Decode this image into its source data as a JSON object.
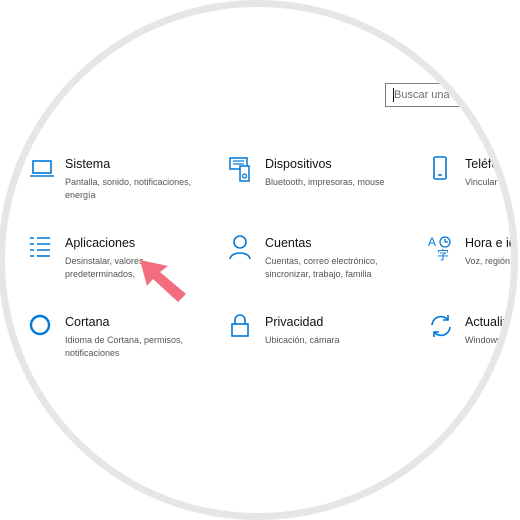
{
  "search": {
    "placeholder": "Buscar una c"
  },
  "items": [
    {
      "title": "Sistema",
      "desc": "Pantalla, sonido, notificaciones, energía",
      "icon": "laptop-icon"
    },
    {
      "title": "Dispositivos",
      "desc": "Bluetooth, impresoras, mouse",
      "icon": "devices-icon"
    },
    {
      "title": "Teléfo",
      "desc": "Vincular",
      "icon": "phone-icon"
    },
    {
      "title": "Aplicaciones",
      "desc": "Desinstalar, valores predeterminados,",
      "icon": "apps-list-icon"
    },
    {
      "title": "Cuentas",
      "desc": "Cuentas, correo electrónico, sincronizar, trabajo, familia",
      "icon": "person-icon"
    },
    {
      "title": "Hora e idi",
      "desc": "Voz, región,",
      "icon": "time-language-icon"
    },
    {
      "title": "Cortana",
      "desc": "Idioma de Cortana, permisos, notificaciones",
      "icon": "cortana-circle-icon"
    },
    {
      "title": "Privacidad",
      "desc": "Ubicación, cámara",
      "icon": "lock-icon"
    },
    {
      "title": "Actualiz",
      "desc": "Windows copia se",
      "icon": "refresh-icon"
    }
  ],
  "colors": {
    "accent": "#0078d7",
    "arrow": "#f26d7d",
    "ring": "#e6e6e6"
  }
}
